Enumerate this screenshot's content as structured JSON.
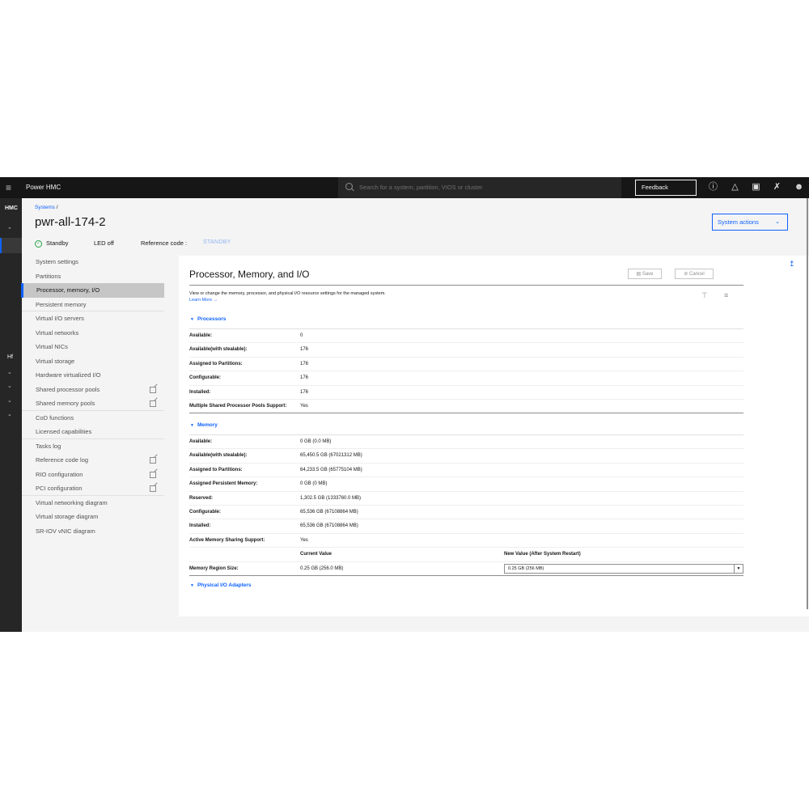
{
  "topbar": {
    "app_name": "Power HMC",
    "search_placeholder": "Search for a system, partition, VIOS or cluster",
    "feedback_label": "Feedback"
  },
  "rail": {
    "hmc_label": "HMC",
    "hf_label": "Hf"
  },
  "header": {
    "breadcrumb_root": "Systems",
    "breadcrumb_sep": "/",
    "system_name": "pwr-all-174-2",
    "state": "Standby",
    "led": "LED off",
    "reference_code_label": "Reference code :",
    "reference_code_value": "STANDBY",
    "system_actions_label": "System actions"
  },
  "nav": {
    "items": [
      {
        "label": "System settings"
      },
      {
        "label": "Partitions"
      },
      {
        "label": "Processor, memory, I/O"
      },
      {
        "label": "Persistent memory"
      },
      {
        "label": "Virtual I/O servers"
      },
      {
        "label": "Virtual networks"
      },
      {
        "label": "Virtual NICs"
      },
      {
        "label": "Virtual storage"
      },
      {
        "label": "Hardware virtualized I/O"
      },
      {
        "label": "Shared processor pools"
      },
      {
        "label": "Shared memory pools"
      },
      {
        "label": "CoD functions"
      },
      {
        "label": "Licensed capabilities"
      },
      {
        "label": "Tasks log"
      },
      {
        "label": "Reference code log"
      },
      {
        "label": "RIO configuration"
      },
      {
        "label": "PCI configuration"
      },
      {
        "label": "Virtual networking diagram"
      },
      {
        "label": "Virtual storage diagram"
      },
      {
        "label": "SR-IOV vNIC diagram"
      }
    ]
  },
  "panel": {
    "title": "Processor, Memory, and I/O",
    "save_label": "Save",
    "cancel_label": "Cancel",
    "description": "View or change the memory, processor, and physical I/O resource settings for the managed system.",
    "learn_more": "Learn More →",
    "processors": {
      "heading": "Processors",
      "rows": [
        {
          "label": "Available:",
          "value": "0"
        },
        {
          "label": "Available(with stealable):",
          "value": "176"
        },
        {
          "label": "Assigned to Partitions:",
          "value": "176"
        },
        {
          "label": "Configurable:",
          "value": "176"
        },
        {
          "label": "Installed:",
          "value": "176"
        },
        {
          "label": "Multiple Shared Processor Pools Support:",
          "value": "Yes"
        }
      ]
    },
    "memory": {
      "heading": "Memory",
      "rows": [
        {
          "label": "Available:",
          "value": "0 GB (0.0 MB)"
        },
        {
          "label": "Available(with stealable):",
          "value": "65,450.5 GB (67021312 MB)"
        },
        {
          "label": "Assigned to Partitions:",
          "value": "64,233.5 GB (65775104 MB)"
        },
        {
          "label": "Assigned Persistent Memory:",
          "value": "0 GB (0 MB)"
        },
        {
          "label": "Reserved:",
          "value": "1,302.5 GB (1333760.0 MB)"
        },
        {
          "label": "Configurable:",
          "value": "65,536 GB (67108864 MB)"
        },
        {
          "label": "Installed:",
          "value": "65,536 GB (67108864 MB)"
        },
        {
          "label": "Active Memory Sharing Support:",
          "value": "Yes"
        }
      ],
      "current_value_header": "Current Value",
      "new_value_header": "New Value (After System Restart)",
      "region_label": "Memory Region Size:",
      "region_current": "0.25 GB (256.0 MB)",
      "region_new": "0.25 GB (256 MB)"
    },
    "physical_io": {
      "heading": "Physical I/O Adapters"
    }
  }
}
